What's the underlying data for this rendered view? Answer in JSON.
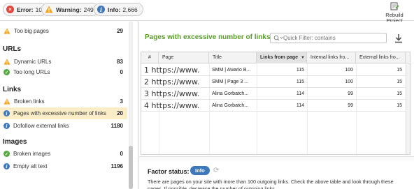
{
  "status_bar": {
    "error": {
      "label": "Error:",
      "count": "10"
    },
    "warning": {
      "label": "Warning:",
      "count": "249"
    },
    "info": {
      "label": "Info:",
      "count": "2,666"
    },
    "rebuild_line1": "Rebuild",
    "rebuild_line2": "Project"
  },
  "sidebar": {
    "top_item": {
      "label": "Too big pages",
      "count": "29",
      "status": "warning"
    },
    "sections": [
      {
        "title": "URLs",
        "items": [
          {
            "label": "Dynamic URLs",
            "count": "83",
            "status": "warning"
          },
          {
            "label": "Too long URLs",
            "count": "0",
            "status": "ok"
          }
        ]
      },
      {
        "title": "Links",
        "items": [
          {
            "label": "Broken links",
            "count": "3",
            "status": "warning"
          },
          {
            "label": "Pages with excessive number of links",
            "count": "20",
            "status": "info",
            "active": true
          },
          {
            "label": "Dofollow external links",
            "count": "1180",
            "status": "info"
          }
        ]
      },
      {
        "title": "Images",
        "items": [
          {
            "label": "Broken images",
            "count": "0",
            "status": "ok"
          },
          {
            "label": "Empty alt text",
            "count": "1196",
            "status": "info"
          }
        ]
      }
    ]
  },
  "main": {
    "title": "Pages with excessive number of links",
    "filter_placeholder": "Quick Filter: contains",
    "columns": [
      "#",
      "Page",
      "Title",
      "Links from page",
      "Internal links fro...",
      "External links fro..."
    ],
    "rows": [
      {
        "num": "1",
        "page": "https://www.",
        "title": "SMM | Awario B...",
        "links": "115",
        "internal": "100",
        "external": "15"
      },
      {
        "num": "2",
        "page": "https://www.",
        "title": "SMM | Page 3 ...",
        "links": "115",
        "internal": "100",
        "external": "15"
      },
      {
        "num": "3",
        "page": "https://www.",
        "title": "Alina Gorbatch...",
        "links": "114",
        "internal": "99",
        "external": "15"
      },
      {
        "num": "4",
        "page": "https://www.",
        "title": "Alina Gorbatch...",
        "links": "114",
        "internal": "99",
        "external": "15"
      }
    ],
    "factor_status_label": "Factor status:",
    "factor_status_value": "Info",
    "factor_description": "There are pages on your site with more than 100 outgoing links. Check the above table and look through these pages. If possible, decrease the number of outgoing links."
  },
  "colors": {
    "error": "#e2453c",
    "warning": "#f2a51a",
    "info": "#3f78b8",
    "ok": "#53a83e",
    "title_green": "#5a9a2c",
    "active_row": "#fbedc7"
  }
}
